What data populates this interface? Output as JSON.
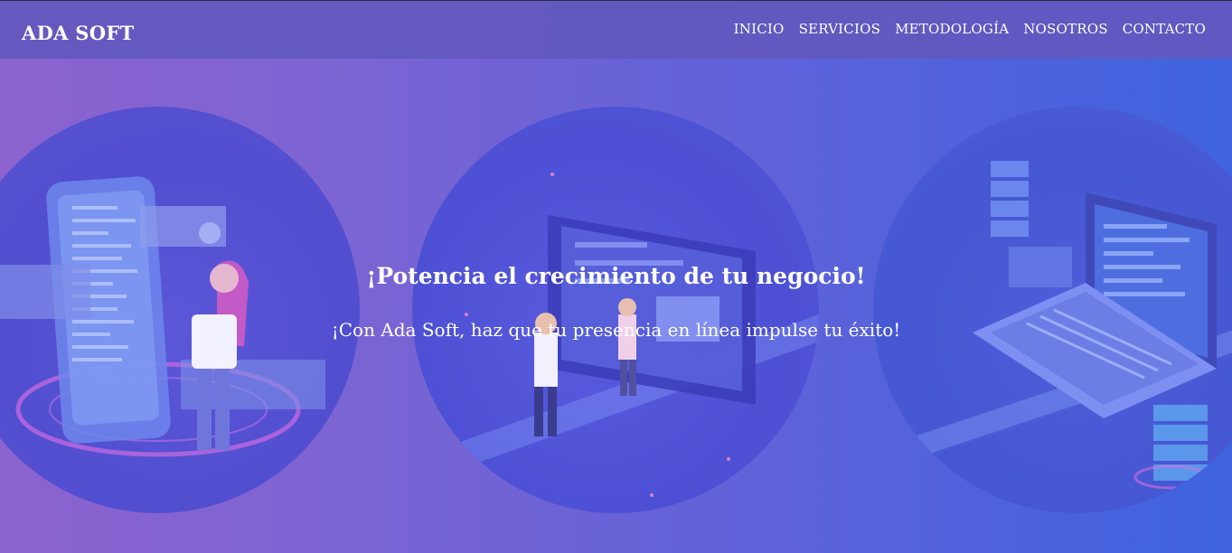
{
  "header": {
    "brand": "ADA SOFT",
    "nav": [
      "INICIO",
      "SERVICIOS",
      "METODOLOGÍA",
      "NOSOTROS",
      "CONTACTO"
    ]
  },
  "hero": {
    "title": "¡Potencia el crecimiento de tu negocio!",
    "subtitle": "¡Con Ada Soft, haz que tu presencia en línea impulse tu éxito!"
  },
  "illustrations": [
    "mobile-app-illustration",
    "dashboard-illustration",
    "laptop-illustration"
  ],
  "colors": {
    "gradient_start": "#8c63cf",
    "gradient_end": "#3f63df",
    "navbar": "#6258be",
    "text": "#ffffff"
  }
}
